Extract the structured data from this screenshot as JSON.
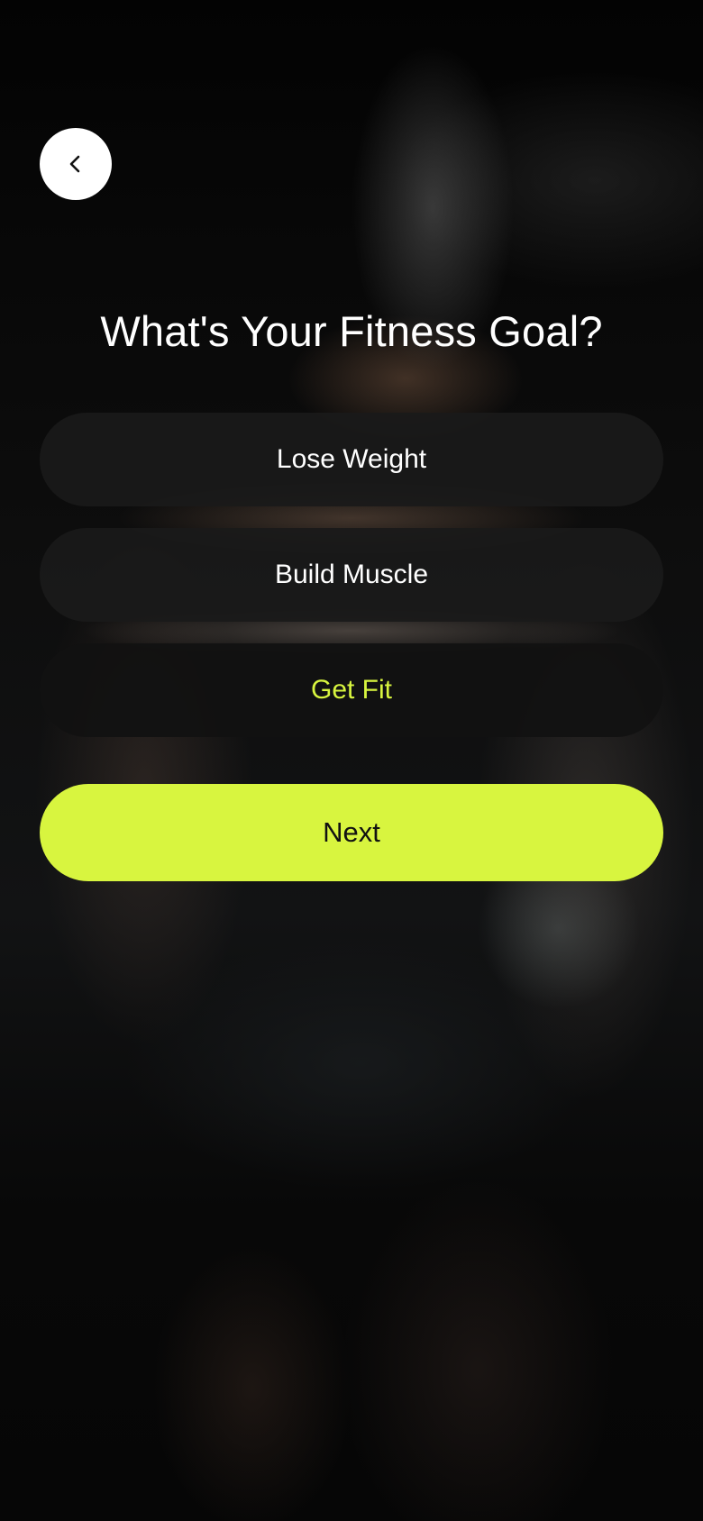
{
  "header": {
    "back_icon": "chevron-left-icon"
  },
  "page": {
    "title": "What's Your Fitness Goal?"
  },
  "options": [
    {
      "label": "Lose Weight",
      "selected": false
    },
    {
      "label": "Build Muscle",
      "selected": false
    },
    {
      "label": "Get Fit",
      "selected": true
    }
  ],
  "actions": {
    "next_label": "Next"
  },
  "colors": {
    "accent": "#d8f53f",
    "option_bg": "#1a1a1a",
    "text": "#ffffff"
  }
}
